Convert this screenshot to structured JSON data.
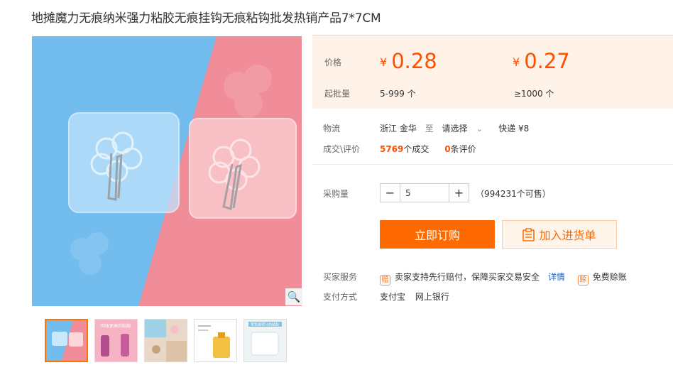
{
  "product": {
    "title": "地摊魔力无痕纳米强力粘胶无痕挂钩无痕粘钩批发热销产品7*7CM"
  },
  "gallery": {
    "zoom_icon": "magnifier-icon",
    "thumbnail_count": 5,
    "thumb_labels": [
      "",
      "回收更高的粘胸",
      "",
      "",
      "零负载荷计的粘贴"
    ]
  },
  "pricing": {
    "price_label": "价格",
    "moq_label": "起批量",
    "currency": "¥",
    "tiers": [
      {
        "price": "0.28",
        "range": "5-999 个"
      },
      {
        "price": "0.27",
        "range": "≥1000 个"
      }
    ],
    "accent": "#ff5000"
  },
  "logistics": {
    "label": "物流",
    "origin": "浙江 金华",
    "to": "至",
    "destination": "请选择",
    "shipping": "快递 ¥8"
  },
  "deals": {
    "label": "成交\\评价",
    "sold_count": "5769",
    "sold_suffix": "个成交",
    "review_count": "0",
    "review_suffix": "条评价"
  },
  "purchase": {
    "label": "采购量",
    "quantity": "5",
    "minus": "−",
    "plus": "+",
    "stock": "（994231个可售）"
  },
  "actions": {
    "buy_now": "立即订购",
    "add_cart": "加入进货单"
  },
  "services": {
    "label": "买家服务",
    "guarantee": "卖家支持先行赔付，保障买家交易安全",
    "details": "详情",
    "free_account": "免费赊账",
    "guarantee_icon": "shield-icon",
    "account_icon": "credit-icon"
  },
  "payment": {
    "label": "支付方式",
    "methods": [
      "支付宝",
      "网上银行"
    ]
  }
}
